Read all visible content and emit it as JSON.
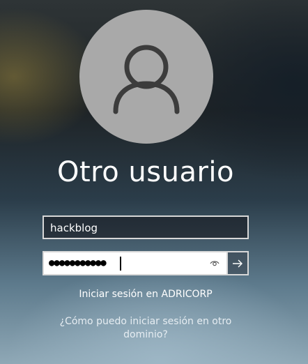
{
  "user": {
    "display_name": "Otro usuario",
    "avatar_icon": "person-outline-icon"
  },
  "login": {
    "username_value": "hackblog",
    "password_masked": "●●●●●●●●●●●",
    "reveal_icon": "eye-icon",
    "submit_icon": "arrow-right-icon"
  },
  "domain": {
    "signin_text": "Iniciar sesión en ADRICORP",
    "other_domain_link": "¿Cómo puedo iniciar sesión en otro dominio?"
  },
  "colors": {
    "avatar_bg": "#a9a9a9",
    "field_border": "#d8d8d8",
    "text": "#ffffff"
  }
}
